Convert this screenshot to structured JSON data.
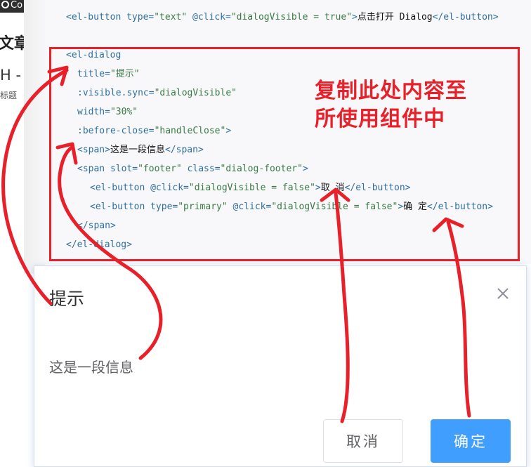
{
  "sidebar": {
    "tab_label": "Co",
    "article_title": "文章",
    "heading_item": "H -",
    "sub_label": "标题"
  },
  "code": {
    "line1": {
      "open": "<el-button ",
      "attr1": "type=",
      "val1": "\"text\"",
      "attr2": " @click=",
      "val2": "\"dialogVisible = true\"",
      "close": ">",
      "text": "点击打开 Dialog",
      "end": "</el-button>"
    },
    "line2": "<el-dialog",
    "line3": {
      "attr": "title=",
      "val": "\"提示\""
    },
    "line4": {
      "attr": ":visible.sync=",
      "val": "\"dialogVisible\""
    },
    "line5": {
      "attr": "width=",
      "val": "\"30%\""
    },
    "line6": {
      "attr": ":before-close=",
      "val": "\"handleClose\"",
      "close": ">"
    },
    "line7": {
      "open": "<span>",
      "text": "这是一段信息",
      "end": "</span>"
    },
    "line8": {
      "open": "<span ",
      "attr1": "slot=",
      "val1": "\"footer\"",
      "attr2": " class=",
      "val2": "\"dialog-footer\"",
      "close": ">"
    },
    "line9": {
      "open": "<el-button ",
      "attr1": "@click=",
      "val1": "\"dialogVisible = false\"",
      "close": ">",
      "text": "取 消",
      "end": "</el-button>"
    },
    "line10": {
      "open": "<el-button ",
      "attr1": "type=",
      "val1": "\"primary\"",
      "attr2": " @click=",
      "val2": "\"dialogVisible = false\"",
      "close": ">",
      "text": "确 定",
      "end": "</el-button>"
    },
    "line11": "</span>",
    "line12": "</el-dialog>"
  },
  "annotation": {
    "line1": "复制此处内容至",
    "line2": "所使用组件中"
  },
  "dialog": {
    "title": "提示",
    "body": "这是一段信息",
    "cancel_label": "取消",
    "confirm_label": "确定"
  },
  "colors": {
    "accent_red": "#e8202a",
    "primary_blue": "#409eff",
    "code_tag": "#2f6f9f",
    "code_string": "#3a7a46"
  },
  "icons": {
    "close": "close-icon"
  }
}
